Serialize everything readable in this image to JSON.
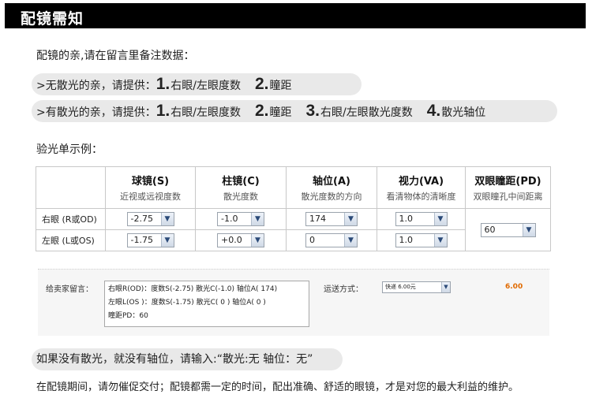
{
  "header": {
    "title": "配镜需知"
  },
  "intro": "配镜的亲,请在留言里备注数据：",
  "no_astig": {
    "prefix": ">无散光的亲，请提供：",
    "items": [
      {
        "num": "1.",
        "text": "右眼/左眼度数"
      },
      {
        "num": "2.",
        "text": "瞳距"
      }
    ]
  },
  "astig": {
    "prefix": ">有散光的亲，请提供：",
    "items": [
      {
        "num": "1.",
        "text": "右眼/左眼度数"
      },
      {
        "num": "2.",
        "text": "瞳距"
      },
      {
        "num": "3.",
        "text": "右眼/左眼散光度数"
      },
      {
        "num": "4.",
        "text": "散光轴位"
      }
    ]
  },
  "example_title": "验光单示例：",
  "table": {
    "columns": [
      {
        "title": "球镜(S)",
        "sub": "近视或远视度数"
      },
      {
        "title": "柱镜(C)",
        "sub": "散光度数"
      },
      {
        "title": "轴位(A)",
        "sub": "散光度数的方向"
      },
      {
        "title": "视力(VA)",
        "sub": "看清物体的清晰度"
      },
      {
        "title": "双眼瞳距(PD)",
        "sub": "双眼瞳孔中间距离"
      }
    ],
    "rows": [
      {
        "label": "右眼 (R或OD)",
        "sph": "-2.75",
        "cyl": "-1.0",
        "axis": "174",
        "va": "1.0"
      },
      {
        "label": "左眼 (L或OS)",
        "sph": "-1.75",
        "cyl": "+0.0",
        "axis": "0",
        "va": "1.0"
      }
    ],
    "pd": "60"
  },
  "message": {
    "label": "给卖家留言：",
    "lines": [
      "右眼R(OD)：度数S(-2.75)   散光C(-1.0)   轴位A( 174)",
      "左眼L(OS )：度数S(-1.75)   散光C( 0 )     轴位A( 0 )",
      "瞳距PD：60"
    ]
  },
  "shipping": {
    "label": "运送方式：",
    "option": "快递 6.00元",
    "price": "6.00"
  },
  "no_astig_note": "如果没有散光，就没有轴位，请输入:“散光:无    轴位：无”",
  "footer_note": "在配镜期间，请勿催促交付；配镜都需一定的时间，配出准确、舒适的眼镜，才是对您的最大利益的维护。",
  "icons": {
    "dropdown": "chevron-down-icon"
  }
}
